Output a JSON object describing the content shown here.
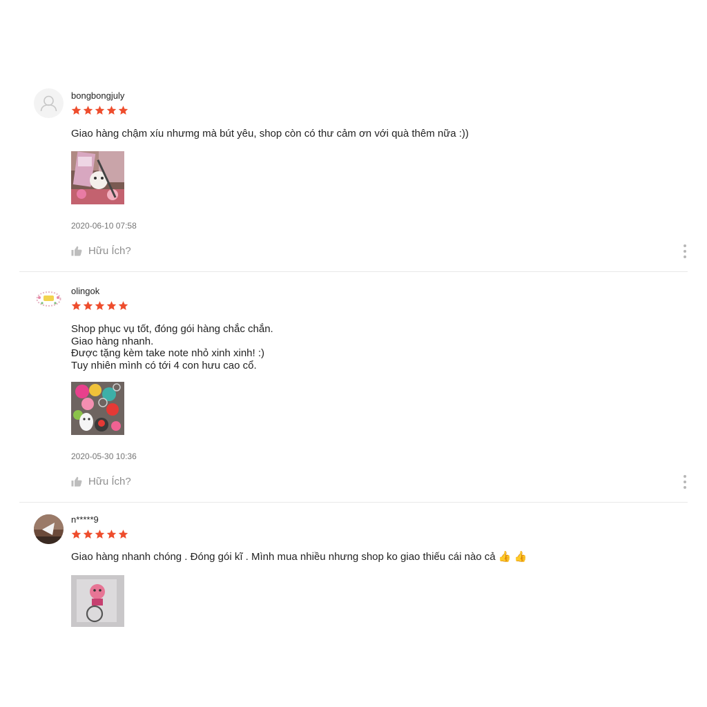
{
  "colors": {
    "star": "#ee4d2d",
    "muted": "#8e8e8e",
    "divider": "#e8e8e8"
  },
  "reviews": [
    {
      "username": "bongbongjuly",
      "rating": 5,
      "comment": "Giao hàng chậm xíu nhưmg mà bút yêu, shop còn có thư cảm ơn với quà thêm nữa :))",
      "timestamp": "2020-06-10 07:58",
      "helpful_label": "Hữu Ích?",
      "avatar_icon": "default-user-icon",
      "image_thumb": "review-photo-pink-pen-thank-you-card"
    },
    {
      "username": "olingok",
      "rating": 5,
      "comment": "Shop phục vụ tốt, đóng gói hàng chắc chắn.\nGiao hàng nhanh.\nĐược tặng kèm take note nhỏ xinh xinh! :)\nTuy nhiên mình có tới 4 con hưu cao cổ.",
      "timestamp": "2020-05-30 10:36",
      "helpful_label": "Hữu Ích?",
      "avatar_icon": "shop-logo-avatar",
      "image_thumb": "review-photo-colorful-keychains"
    },
    {
      "username": "n*****9",
      "rating": 5,
      "comment": "Giao hàng nhanh chóng . Đóng gói kĩ . Mình mua nhiều nhưng shop ko giao thiếu cái nào cả 👍 👍",
      "avatar_icon": "photo-avatar",
      "image_thumb": "review-photo-keychain-in-bag"
    }
  ]
}
